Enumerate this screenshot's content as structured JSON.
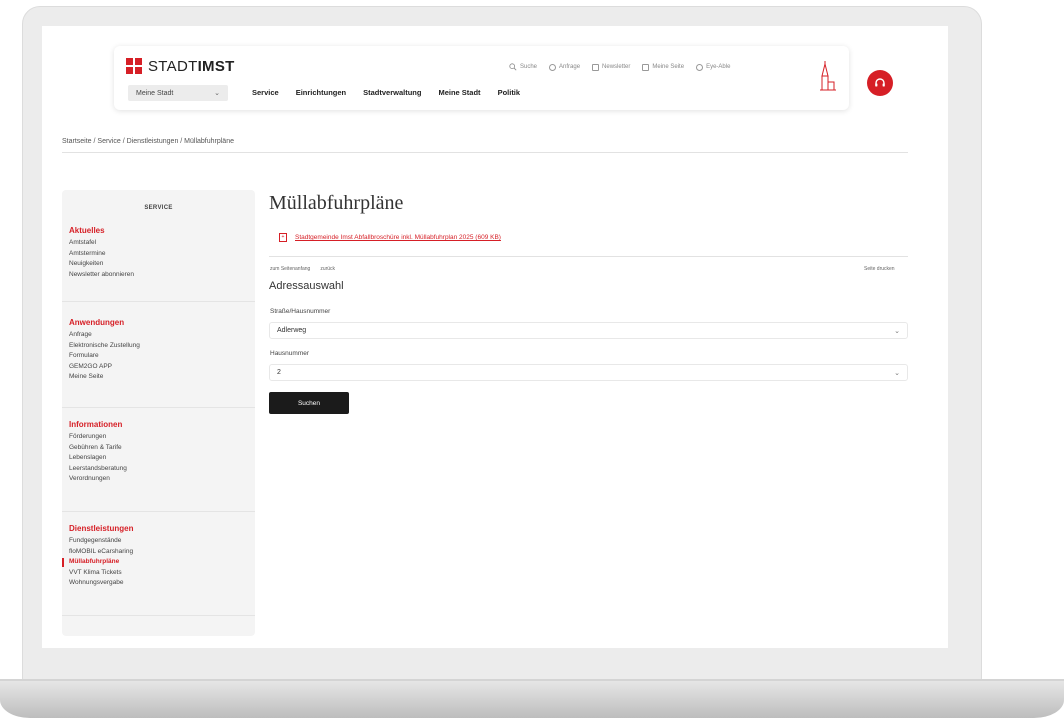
{
  "header": {
    "logo_prefix": "STADT",
    "logo_strong": "IMST",
    "city_select": "Meine Stadt",
    "main_nav": [
      "Service",
      "Einrichtungen",
      "Stadtverwaltung",
      "Meine Stadt",
      "Politik"
    ],
    "util_nav": [
      {
        "label": "Suche",
        "icon": "search-icon"
      },
      {
        "label": "Anfrage",
        "icon": "chat-icon"
      },
      {
        "label": "Newsletter",
        "icon": "newsletter-icon"
      },
      {
        "label": "Meine Seite",
        "icon": "user-icon"
      },
      {
        "label": "Eye-Able",
        "icon": "accessibility-icon"
      }
    ],
    "brand_color": "#d61f26"
  },
  "breadcrumb": "Startseite / Service / Dienstleistungen / Müllabfuhrpläne",
  "sidebar": {
    "heading": "SERVICE",
    "sections": [
      {
        "title": "Aktuelles",
        "items": [
          "Amtstafel",
          "Amtstermine",
          "Neuigkeiten",
          "Newsletter abonnieren"
        ]
      },
      {
        "title": "Anwendungen",
        "items": [
          "Anfrage",
          "Elektronische Zustellung",
          "Formulare",
          "GEM2GO APP",
          "Meine Seite"
        ]
      },
      {
        "title": "Informationen",
        "items": [
          "Förderungen",
          "Gebühren & Tarife",
          "Lebenslagen",
          "Leerstandsberatung",
          "Verordnungen"
        ]
      },
      {
        "title": "Dienstleistungen",
        "items": [
          "Fundgegenstände",
          "floMOBIL eCarsharing",
          "Müllabfuhrpläne",
          "VVT Klima Tickets",
          "Wohnungsvergabe"
        ]
      }
    ],
    "active_item": "Müllabfuhrpläne"
  },
  "main": {
    "title": "Müllabfuhrpläne",
    "pdf_link": "Stadtgemeinde Imst Abfallbroschüre inkl. Müllabfuhrplan 2025 (609 KB)",
    "tool_top": "zum Seitenanfang",
    "tool_back": "zurück",
    "tool_print": "Seite drucken",
    "section_title": "Adressauswahl",
    "street_label": "Straße/Hausnummer",
    "street_value": "Adlerweg",
    "house_label": "Hausnummer",
    "house_value": "2",
    "submit_label": "Suchen"
  }
}
